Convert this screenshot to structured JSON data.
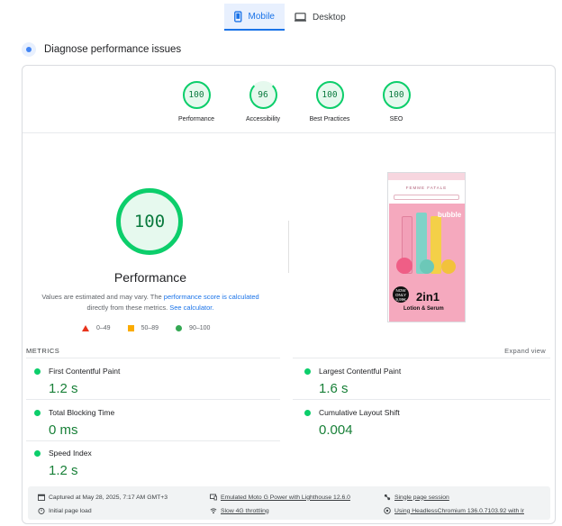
{
  "tabs": [
    {
      "label": "Mobile",
      "icon": "mobile-icon",
      "active": true
    },
    {
      "label": "Desktop",
      "icon": "desktop-icon",
      "active": false
    }
  ],
  "section": {
    "title": "Diagnose performance issues"
  },
  "categories": [
    {
      "score": "100",
      "label": "Performance"
    },
    {
      "score": "96",
      "label": "Accessibility"
    },
    {
      "score": "100",
      "label": "Best Practices"
    },
    {
      "score": "100",
      "label": "SEO"
    }
  ],
  "main_score": {
    "score": "100",
    "label": "Performance"
  },
  "note": {
    "part1": "Values are estimated and may vary. The ",
    "link1": "performance score is calculated",
    "part2": " directly from these metrics. ",
    "link2": "See calculator."
  },
  "legend": [
    {
      "range": "0–49",
      "color": "#e8331c"
    },
    {
      "range": "50–89",
      "color": "#fbab00"
    },
    {
      "range": "90–100",
      "color": "#34a853"
    }
  ],
  "screenshot": {
    "brand": "FEMME FATALE",
    "bubble": "bubble",
    "price": "NOW ONLY 9,99€",
    "headline": "2in1",
    "subline": "Lotion & Serum"
  },
  "metrics": {
    "header": "METRICS",
    "expand": "Expand view",
    "items": [
      {
        "name": "First Contentful Paint",
        "value": "1.2 s"
      },
      {
        "name": "Largest Contentful Paint",
        "value": "1.6 s"
      },
      {
        "name": "Total Blocking Time",
        "value": "0 ms"
      },
      {
        "name": "Cumulative Layout Shift",
        "value": "0.004"
      },
      {
        "name": "Speed Index",
        "value": "1.2 s"
      }
    ]
  },
  "footer": {
    "captured": "Captured at May 28, 2025, 7:17 AM GMT+3",
    "device": "Emulated Moto G Power with Lighthouse 12.6.0",
    "session": "Single page session",
    "load": "Initial page load",
    "throttling": "Slow 4G throttling",
    "browser": "Using HeadlessChromium 136.0.7103.92 with lr"
  },
  "colors": {
    "pass": "#0cce6b",
    "accent": "#1a73e8",
    "value_green": "#188038"
  }
}
